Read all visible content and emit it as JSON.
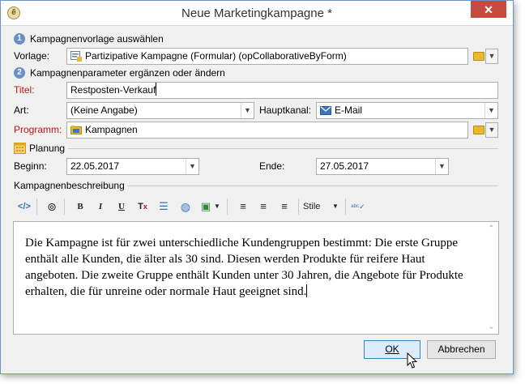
{
  "window": {
    "title": "Neue Marketingkampagne *",
    "close_label": "✕"
  },
  "section1": {
    "step": "1",
    "title": "Kampagnenvorlage auswählen",
    "vorlage_label": "Vorlage:",
    "vorlage_value": "Partizipative Kampagne (Formular) (opCollaborativeByForm)"
  },
  "section2": {
    "step": "2",
    "title": "Kampagnenparameter ergänzen oder ändern",
    "titel_label": "Titel:",
    "titel_value": "Restposten-Verkauf",
    "art_label": "Art:",
    "art_value": "(Keine Angabe)",
    "hauptkanal_label": "Hauptkanal:",
    "hauptkanal_value": "E-Mail",
    "programm_label": "Programm:",
    "programm_value": "Kampagnen"
  },
  "planung": {
    "title": "Planung",
    "beginn_label": "Beginn:",
    "beginn_value": "22.05.2017",
    "ende_label": "Ende:",
    "ende_value": "27.05.2017"
  },
  "beschreibung": {
    "title": "Kampagnenbeschreibung",
    "toolbar": {
      "bold": "B",
      "italic": "I",
      "underline": "U",
      "styles": "Stile"
    },
    "text": "Die Kampagne ist für zwei unterschiedliche Kundengruppen bestimmt: Die erste Gruppe enthält alle Kunden, die älter als 30 sind. Diesen werden Produkte für reifere Haut angeboten. Die zweite Gruppe enthält Kunden unter 30 Jahren, die Angebote für Produkte erhalten, die für unreine oder normale Haut geeignet sind."
  },
  "buttons": {
    "ok": "OK",
    "cancel": "Abbrechen"
  },
  "colors": {
    "accent": "#6a8fc7",
    "required_label": "#c0141a",
    "close_button": "#c74a3e"
  }
}
